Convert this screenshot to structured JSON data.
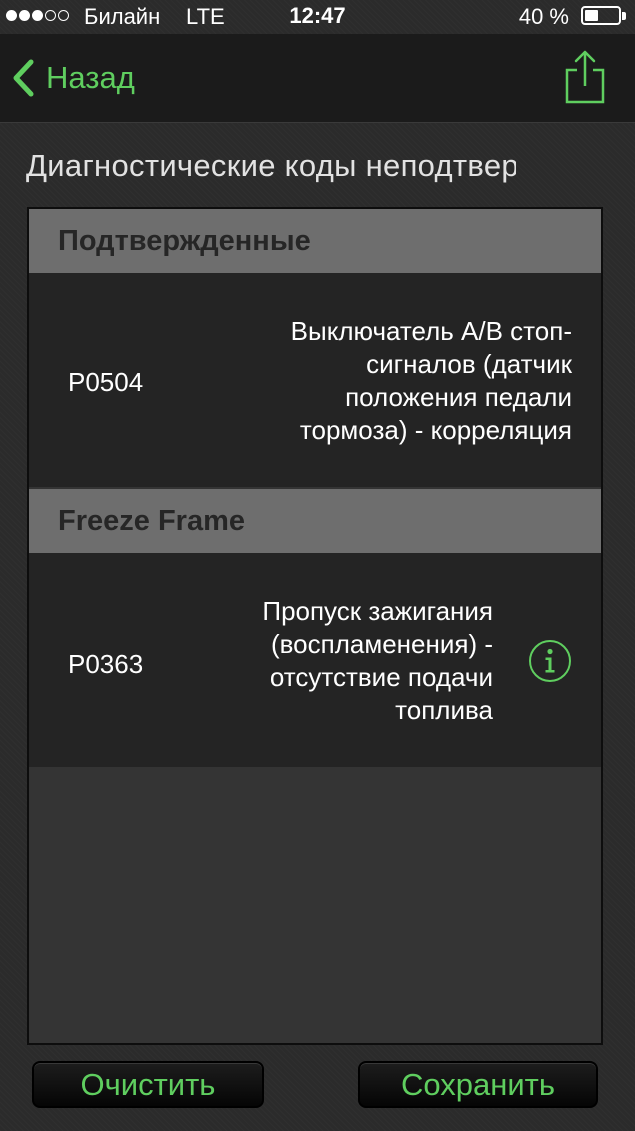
{
  "status_bar": {
    "carrier": "Билайн",
    "network": "LTE",
    "time": "12:47",
    "battery_percent": "40 %",
    "signal_bars": 3,
    "signal_total": 5,
    "battery_level": 0.4
  },
  "nav": {
    "back_label": "Назад",
    "back_icon": "chevron-left-icon",
    "share_icon": "share-icon"
  },
  "page": {
    "title": "Диагностические коды неподтвержденные"
  },
  "sections": [
    {
      "header": "Подтвержденные",
      "rows": [
        {
          "code": "P0504",
          "description_lines": [
            "Выключатель A/B стоп-",
            "сигналов (датчик",
            "положения педали",
            "тормоза) - корреляция"
          ],
          "has_info": false
        }
      ]
    },
    {
      "header": "Freeze Frame",
      "rows": [
        {
          "code": "P0363",
          "description_lines": [
            "Пропуск зажигания",
            "(воспламенения) -",
            "отсутствие подачи",
            "топлива"
          ],
          "has_info": true,
          "info_icon": "info-icon"
        }
      ]
    }
  ],
  "buttons": {
    "clear_label": "Очистить",
    "save_label": "Сохранить"
  },
  "colors": {
    "accent": "#5fce5f",
    "background": "#2b2b2b",
    "section_header_bg": "#6e6e6e",
    "row_bg": "#242424"
  }
}
